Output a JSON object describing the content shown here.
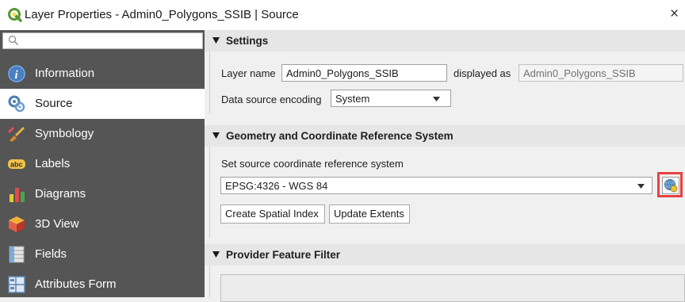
{
  "window": {
    "title": "Layer Properties - Admin0_Polygons_SSIB | Source",
    "app_icon": "qgis-logo-icon",
    "close_symbol": "×"
  },
  "sidebar": {
    "search": {
      "value": "",
      "placeholder": ""
    },
    "items": [
      {
        "label": "Information",
        "icon": "information-icon",
        "active": false
      },
      {
        "label": "Source",
        "icon": "source-icon",
        "active": true
      },
      {
        "label": "Symbology",
        "icon": "symbology-icon",
        "active": false
      },
      {
        "label": "Labels",
        "icon": "labels-icon",
        "active": false
      },
      {
        "label": "Diagrams",
        "icon": "diagrams-icon",
        "active": false
      },
      {
        "label": "3D View",
        "icon": "3d-view-icon",
        "active": false
      },
      {
        "label": "Fields",
        "icon": "fields-icon",
        "active": false
      },
      {
        "label": "Attributes Form",
        "icon": "attributes-form-icon",
        "active": false
      }
    ]
  },
  "settings": {
    "header": "Settings",
    "layer_name_label": "Layer name",
    "layer_name_value": "Admin0_Polygons_SSIB",
    "displayed_as_label": "displayed as",
    "displayed_as_value": "Admin0_Polygons_SSIB",
    "encoding_label": "Data source encoding",
    "encoding_value": "System"
  },
  "geometry": {
    "header": "Geometry and Coordinate Reference System",
    "crs_label": "Set source coordinate reference system",
    "crs_value": "EPSG:4326 - WGS 84",
    "create_index_button": "Create Spatial Index",
    "update_extents_button": "Update Extents",
    "crs_button_icon": "globe-crs-icon"
  },
  "filter": {
    "header": "Provider Feature Filter"
  },
  "colors": {
    "sidebar_bg": "#555555",
    "highlight_border": "#e8413f",
    "section_header_bg": "#e6e6e6"
  }
}
